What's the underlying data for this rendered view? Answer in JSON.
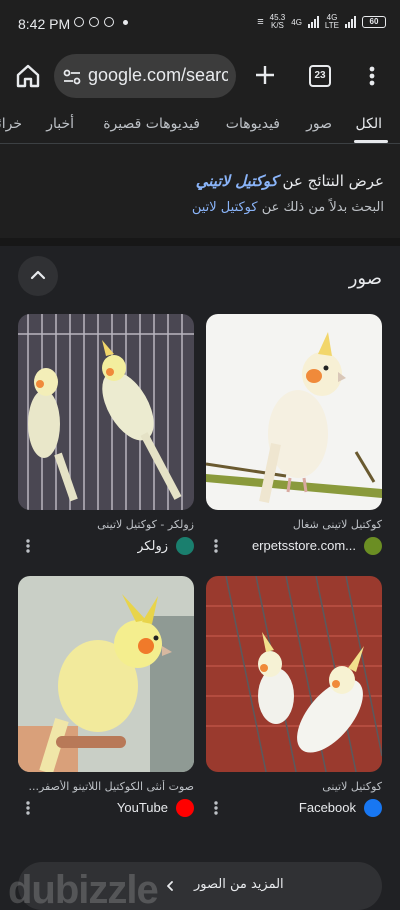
{
  "status_bar": {
    "time": "8:42 PM",
    "net_speed_value": "45.3",
    "net_speed_unit": "K/S",
    "network_1": "4G",
    "network_2": "4G",
    "network_2_sub": "LTE",
    "battery": "60"
  },
  "browser": {
    "url": "google.com/search",
    "tab_count": "23"
  },
  "search_tabs": [
    {
      "label": "الكل",
      "active": true
    },
    {
      "label": "صور",
      "active": false
    },
    {
      "label": "فيديوهات",
      "active": false
    },
    {
      "label": "فيديوهات قصيرة",
      "active": false
    },
    {
      "label": "أخبار",
      "active": false
    },
    {
      "label": "خرائط",
      "active": false
    }
  ],
  "spelling": {
    "prefix": "عرض النتائج عن",
    "corrected_query": "كوكتيل لاتيني",
    "instead_prefix": "البحث بدلاً من ذلك عن",
    "original_query": "كوكتيل لاتين"
  },
  "images_section": {
    "title": "صور",
    "results": [
      {
        "caption": "كوكتيل لاتينى شغال",
        "source": "erpetsstore.com...",
        "favicon_color": "#6b8e23",
        "icon": "leaf-icon"
      },
      {
        "caption": "زولكر - كوكتيل لاتينى",
        "source": "زولكر",
        "favicon_color": "#1a7f6e",
        "icon": "paw-icon"
      },
      {
        "caption": "كوكتيل لاتينى",
        "source": "Facebook",
        "favicon_color": "#1877f2",
        "icon": "facebook-icon"
      },
      {
        "caption": "صوت أنثى الكوكتيل اللاتينو الأصفر...",
        "source": "YouTube",
        "favicon_color": "#ff0000",
        "icon": "youtube-icon"
      }
    ],
    "more_label": "المزيد من الصور"
  },
  "watermark": "dubizzle"
}
